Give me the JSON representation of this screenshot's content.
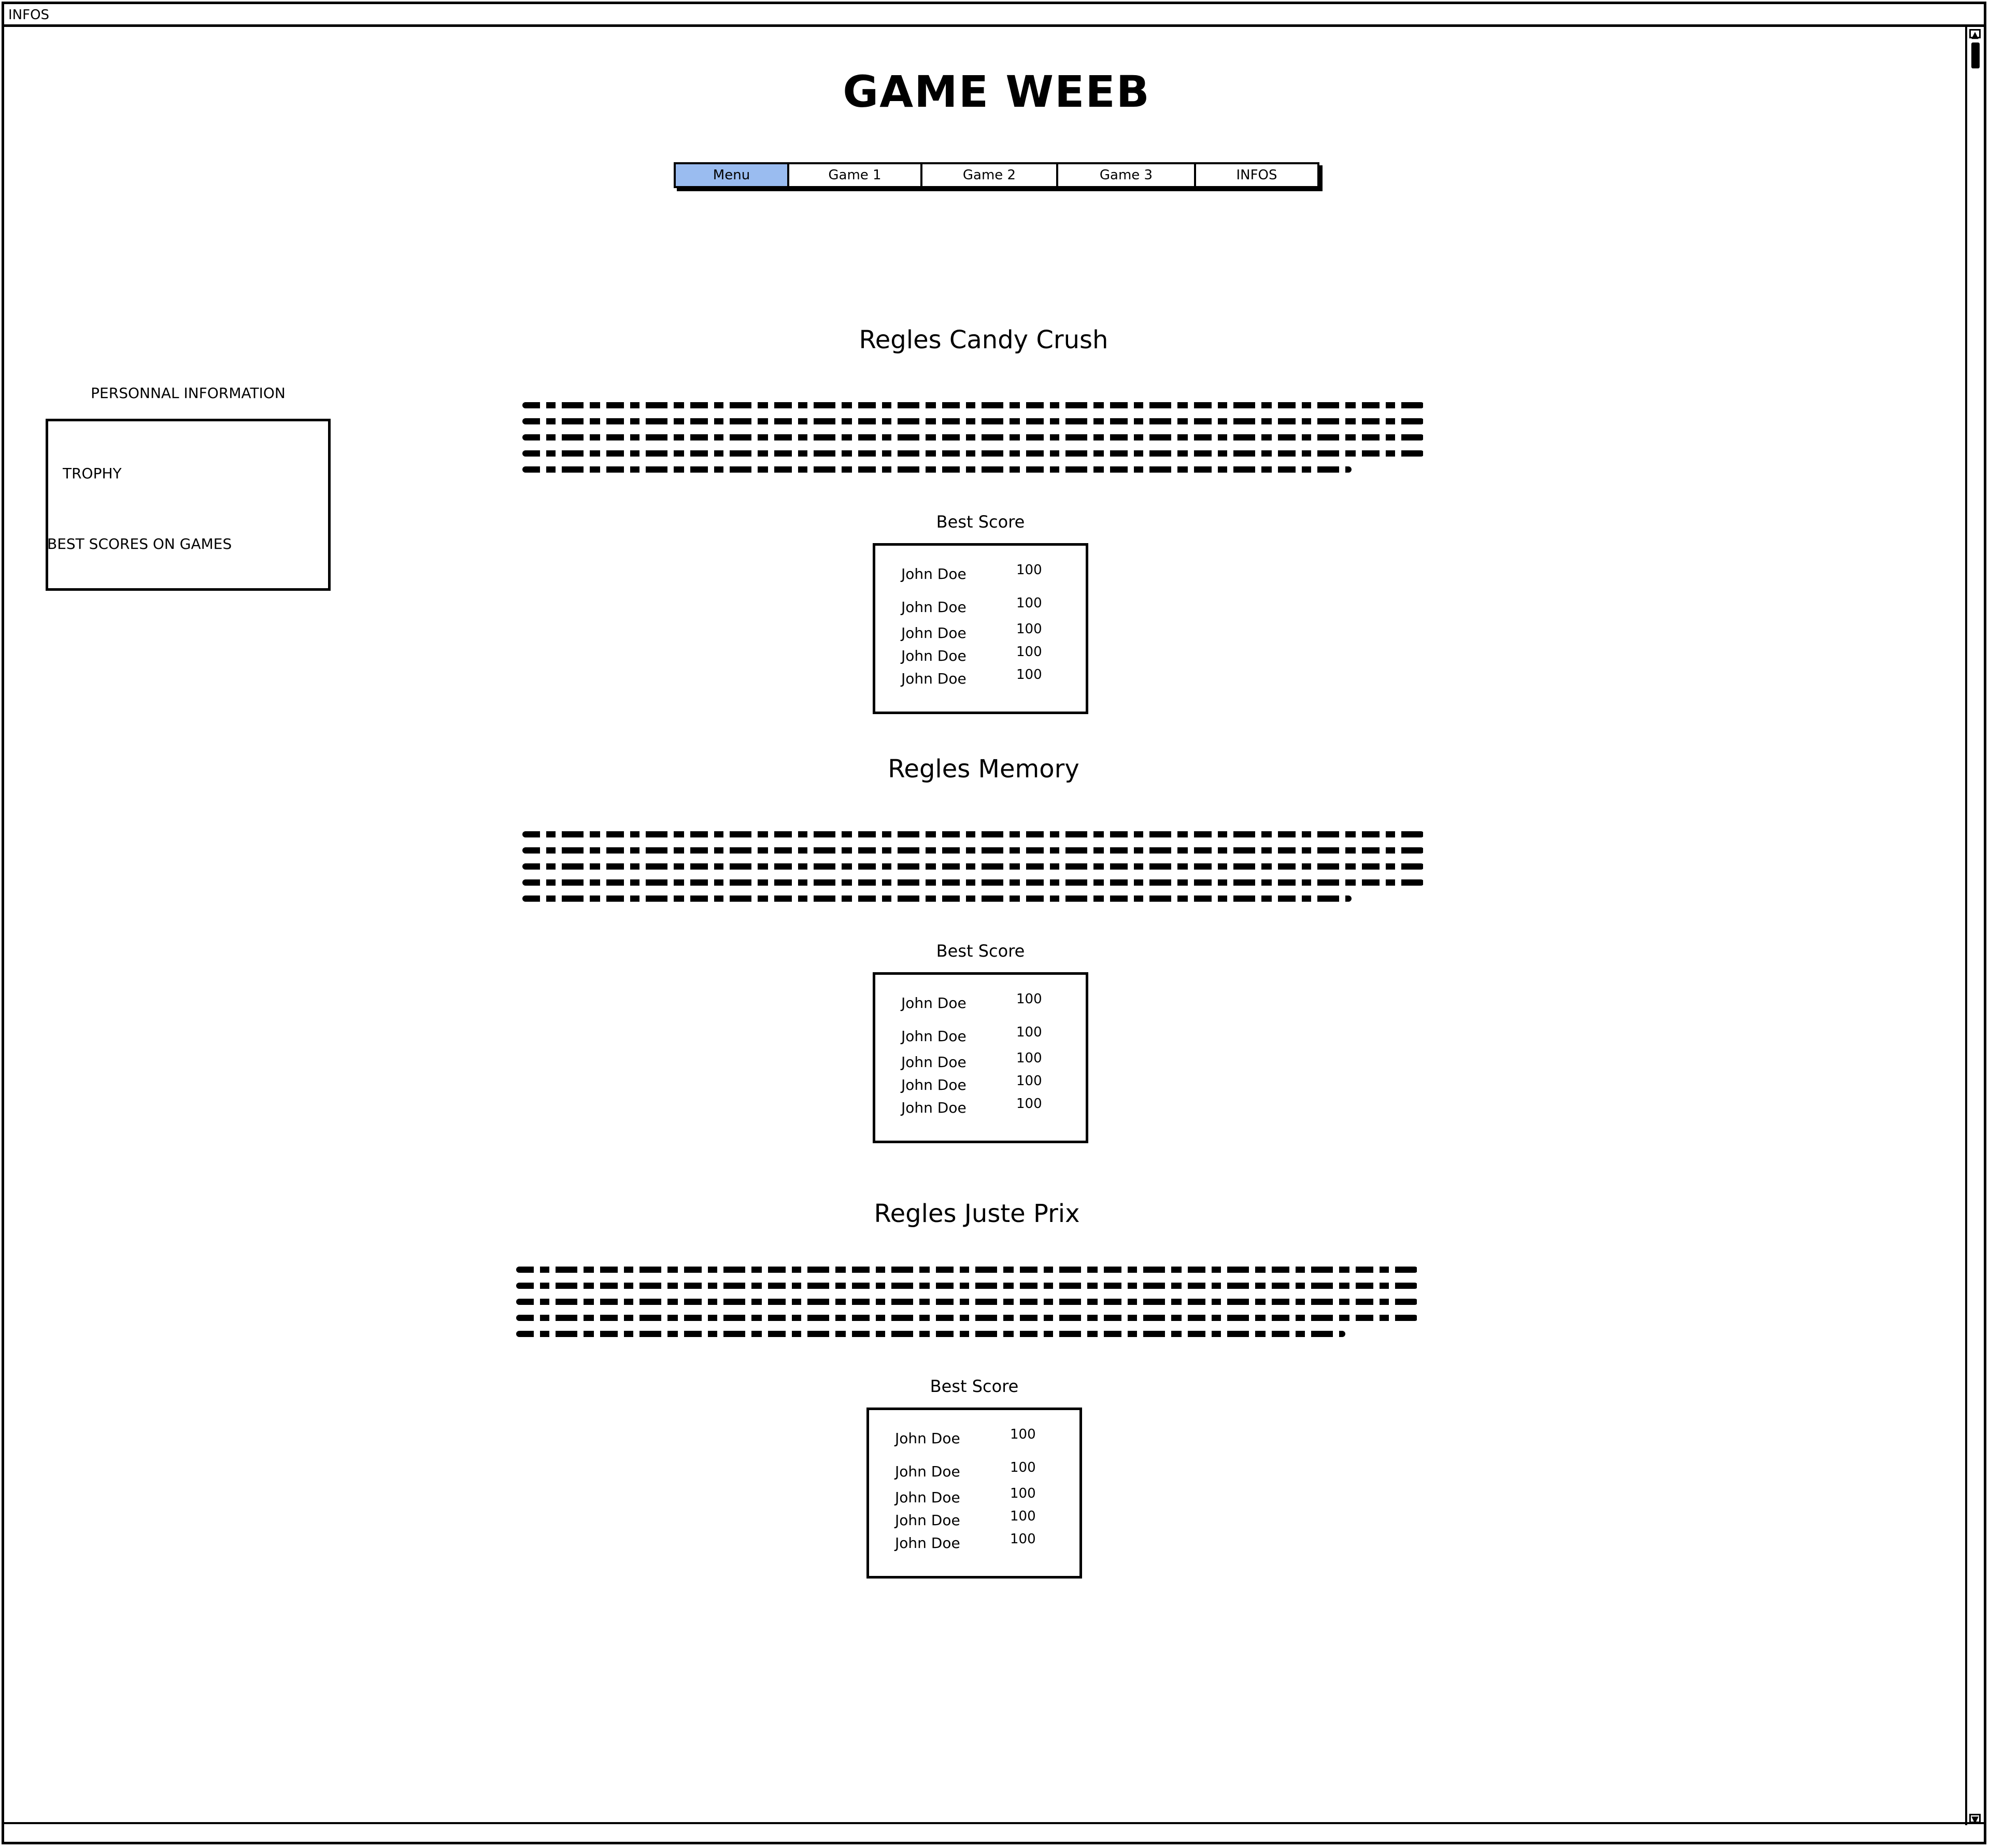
{
  "window": {
    "title": "INFOS"
  },
  "page": {
    "title": "GAME WEEB"
  },
  "nav": {
    "items": [
      {
        "label": "Menu",
        "active": true
      },
      {
        "label": "Game 1",
        "active": false
      },
      {
        "label": "Game 2",
        "active": false
      },
      {
        "label": "Game 3",
        "active": false
      },
      {
        "label": "INFOS",
        "active": false
      }
    ]
  },
  "sidebar": {
    "heading": "PERSONNAL INFORMATION",
    "trophy": "TROPHY",
    "best_scores": "BEST SCORES ON GAMES"
  },
  "sections": [
    {
      "title": "Regles Candy Crush",
      "best_label": "Best Score",
      "scores": [
        {
          "name": "John Doe",
          "value": "100"
        },
        {
          "name": "John Doe",
          "value": "100"
        },
        {
          "name": "John Doe",
          "value": "100"
        },
        {
          "name": "John Doe",
          "value": "100"
        },
        {
          "name": "John Doe",
          "value": "100"
        }
      ]
    },
    {
      "title": "Regles Memory",
      "best_label": "Best Score",
      "scores": [
        {
          "name": "John Doe",
          "value": "100"
        },
        {
          "name": "John Doe",
          "value": "100"
        },
        {
          "name": "John Doe",
          "value": "100"
        },
        {
          "name": "John Doe",
          "value": "100"
        },
        {
          "name": "John Doe",
          "value": "100"
        }
      ]
    },
    {
      "title": "Regles Juste Prix",
      "best_label": "Best Score",
      "scores": [
        {
          "name": "John Doe",
          "value": "100"
        },
        {
          "name": "John Doe",
          "value": "100"
        },
        {
          "name": "John Doe",
          "value": "100"
        },
        {
          "name": "John Doe",
          "value": "100"
        },
        {
          "name": "John Doe",
          "value": "100"
        }
      ]
    }
  ],
  "colors": {
    "nav_active": "#9abcf0",
    "ink": "#000000",
    "background": "#ffffff"
  }
}
